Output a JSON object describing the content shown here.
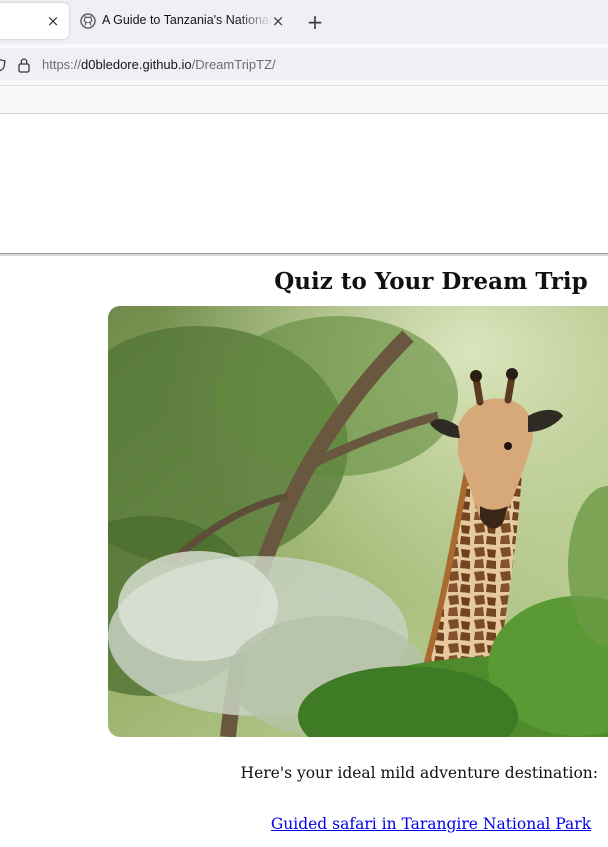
{
  "browser": {
    "active_tab": {
      "title": "",
      "close_icon": "×"
    },
    "tabs": [
      {
        "title": "A Guide to Tanzania's National Parks",
        "icon": "github-icon",
        "close_icon": "×"
      }
    ],
    "new_tab_icon": "+",
    "url": {
      "scheme": "https://",
      "host": "d0bledore.github.io",
      "path": "/DreamTripTZ/"
    }
  },
  "page": {
    "title": "Quiz to Your Dream Trip",
    "hero_image": {
      "alt": "Giraffe peeking over green bushes",
      "sky_color": "#b9cc8f",
      "foliage_color": "#5b8a3a"
    },
    "result_text": "Here's your ideal mild adventure destination:",
    "result_link": "Guided safari in Tarangire National Park"
  },
  "colors": {
    "tabbar": "#f0f0f4",
    "link": "#0000ee",
    "text": "#111111"
  }
}
